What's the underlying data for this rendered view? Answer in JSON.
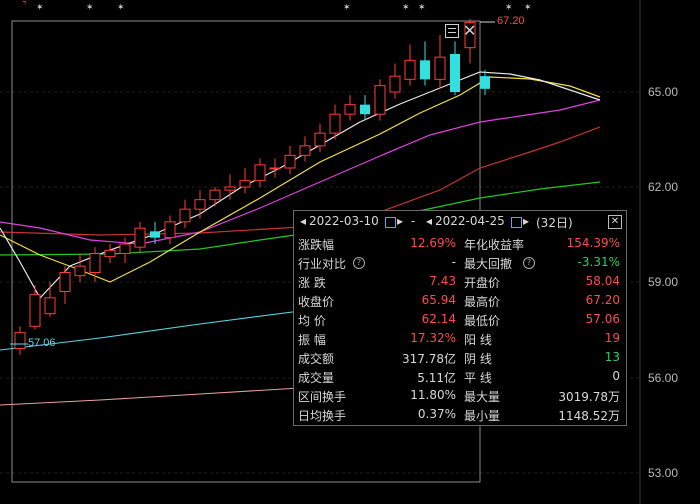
{
  "price_axis": {
    "labels": [
      "65.00",
      "62.00",
      "59.00",
      "56.00",
      "53.00"
    ]
  },
  "annotations": {
    "high": "67.20",
    "low": "57.06"
  },
  "stats": {
    "start_date": "2022-03-10",
    "end_date": "2022-04-25",
    "days": "(32日)",
    "rows": [
      {
        "l1": "涨跌幅",
        "v1": "12.69%",
        "c1": "r",
        "l2": "年化收益率",
        "v2": "154.39%",
        "c2": "r"
      },
      {
        "l1": "行业对比",
        "q1": "?",
        "v1": "-",
        "c1": "w",
        "l2": "最大回撤",
        "q2": "?",
        "v2": "-3.31%",
        "c2": "g"
      },
      {
        "l1": "涨  跌",
        "v1": "7.43",
        "c1": "r",
        "l2": "开盘价",
        "v2": "58.04",
        "c2": "r"
      },
      {
        "l1": "收盘价",
        "v1": "65.94",
        "c1": "r",
        "l2": "最高价",
        "v2": "67.20",
        "c2": "r"
      },
      {
        "l1": "均  价",
        "v1": "62.14",
        "c1": "r",
        "l2": "最低价",
        "v2": "57.06",
        "c2": "r"
      },
      {
        "l1": "振  幅",
        "v1": "17.32%",
        "c1": "r",
        "l2": "阳  线",
        "v2": "19",
        "c2": "r"
      },
      {
        "l1": "成交额",
        "v1": "317.78亿",
        "c1": "w",
        "l2": "阴  线",
        "v2": "13",
        "c2": "g"
      },
      {
        "l1": "成交量",
        "v1": "5.11亿",
        "c1": "w",
        "l2": "平  线",
        "v2": "0",
        "c2": "w"
      },
      {
        "l1": "区间换手",
        "v1": "11.80%",
        "c1": "w",
        "l2": "最大量",
        "v2": "3019.78万",
        "c2": "w"
      },
      {
        "l1": "日均换手",
        "v1": "0.37%",
        "c1": "w",
        "l2": "最小量",
        "v2": "1148.52万",
        "c2": "w"
      }
    ]
  },
  "colors": {
    "up": "#ff3b3b",
    "down": "#33e0e0",
    "ma5": "#e8e8e8",
    "ma10": "#f0e040",
    "ma20": "#e040e0",
    "ma30": "#c83232",
    "ma60": "#22c822"
  },
  "chart_data": {
    "type": "candlestick",
    "price_range": [
      53.0,
      67.5
    ],
    "candles": [
      {
        "o": 56.9,
        "c": 57.4,
        "h": 57.6,
        "l": 56.7
      },
      {
        "o": 57.6,
        "c": 58.6,
        "h": 58.9,
        "l": 57.5
      },
      {
        "o": 58.0,
        "c": 58.5,
        "h": 59.0,
        "l": 57.9
      },
      {
        "o": 58.7,
        "c": 59.3,
        "h": 59.5,
        "l": 58.3
      },
      {
        "o": 59.2,
        "c": 59.5,
        "h": 59.9,
        "l": 59.0
      },
      {
        "o": 59.3,
        "c": 59.9,
        "h": 60.1,
        "l": 59.0
      },
      {
        "o": 59.8,
        "c": 60.0,
        "h": 60.2,
        "l": 59.6
      },
      {
        "o": 59.9,
        "c": 60.2,
        "h": 60.4,
        "l": 59.6
      },
      {
        "o": 60.1,
        "c": 60.7,
        "h": 60.9,
        "l": 59.9
      },
      {
        "o": 60.6,
        "c": 60.4,
        "h": 60.9,
        "l": 60.2
      },
      {
        "o": 60.4,
        "c": 60.9,
        "h": 61.1,
        "l": 60.2
      },
      {
        "o": 60.9,
        "c": 61.3,
        "h": 61.6,
        "l": 60.7
      },
      {
        "o": 61.3,
        "c": 61.6,
        "h": 61.9,
        "l": 61.0
      },
      {
        "o": 61.6,
        "c": 61.9,
        "h": 62.0,
        "l": 61.4
      },
      {
        "o": 61.9,
        "c": 62.0,
        "h": 62.4,
        "l": 61.6
      },
      {
        "o": 62.0,
        "c": 62.2,
        "h": 62.6,
        "l": 61.8
      },
      {
        "o": 62.2,
        "c": 62.7,
        "h": 62.9,
        "l": 62.0
      },
      {
        "o": 62.6,
        "c": 62.6,
        "h": 62.9,
        "l": 62.3
      },
      {
        "o": 62.6,
        "c": 63.0,
        "h": 63.3,
        "l": 62.4
      },
      {
        "o": 63.0,
        "c": 63.3,
        "h": 63.6,
        "l": 62.8
      },
      {
        "o": 63.3,
        "c": 63.7,
        "h": 64.0,
        "l": 63.1
      },
      {
        "o": 63.7,
        "c": 64.3,
        "h": 64.6,
        "l": 63.5
      },
      {
        "o": 64.3,
        "c": 64.6,
        "h": 64.9,
        "l": 64.1
      },
      {
        "o": 64.6,
        "c": 64.3,
        "h": 64.9,
        "l": 64.1
      },
      {
        "o": 64.3,
        "c": 65.2,
        "h": 65.4,
        "l": 64.1
      },
      {
        "o": 65.0,
        "c": 65.5,
        "h": 65.9,
        "l": 64.8
      },
      {
        "o": 65.4,
        "c": 66.0,
        "h": 66.5,
        "l": 65.2
      },
      {
        "o": 66.0,
        "c": 65.4,
        "h": 66.6,
        "l": 65.2
      },
      {
        "o": 65.4,
        "c": 66.1,
        "h": 66.8,
        "l": 65.1
      },
      {
        "o": 66.2,
        "c": 65.0,
        "h": 66.6,
        "l": 64.9
      },
      {
        "o": 66.4,
        "c": 67.2,
        "h": 67.3,
        "l": 65.9
      },
      {
        "o": 65.5,
        "c": 65.1,
        "h": 65.7,
        "l": 64.9
      }
    ]
  }
}
